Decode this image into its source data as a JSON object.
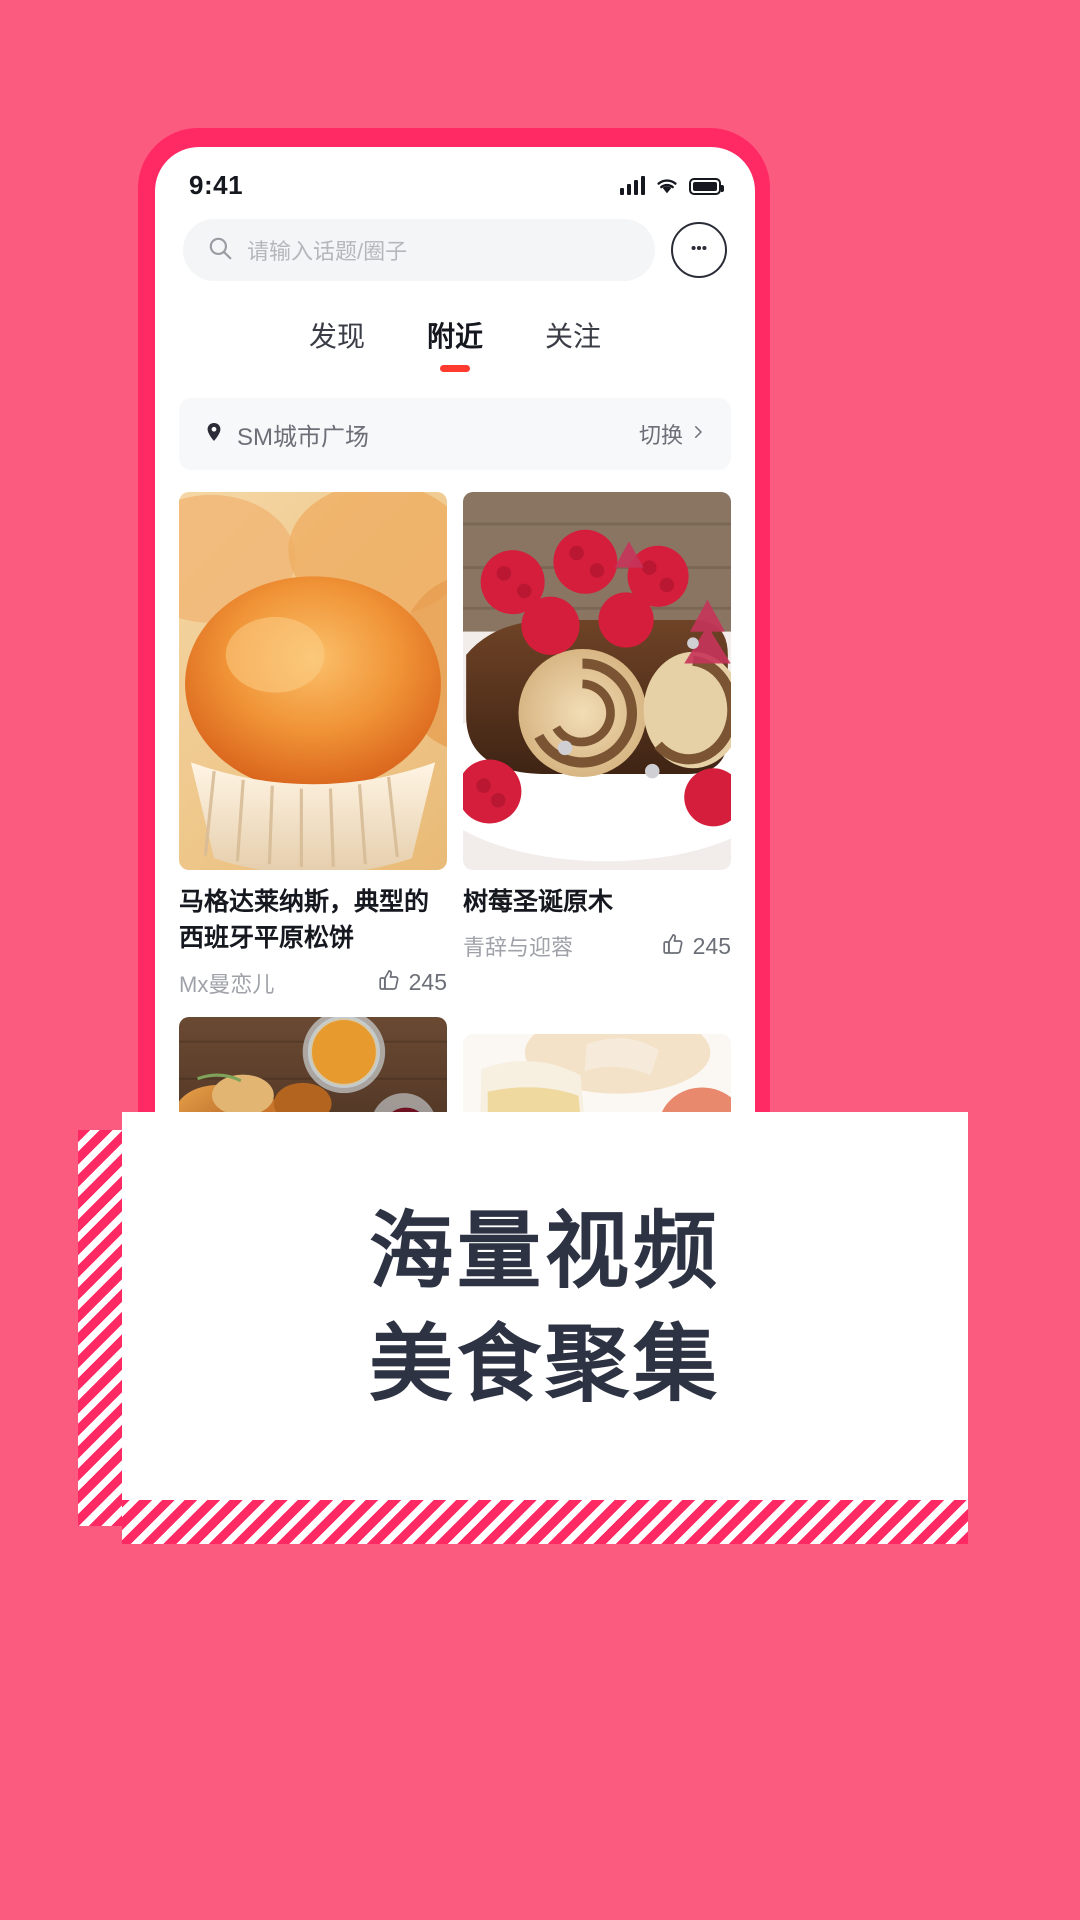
{
  "theme": {
    "bg_pink": "#FC5B80",
    "deep_pink": "#FF2A63",
    "accent_red": "#FF3B30",
    "headline_color": "#2E3344"
  },
  "status_bar": {
    "time": "9:41",
    "icons": [
      "signal-icon",
      "wifi-icon",
      "battery-icon"
    ]
  },
  "search": {
    "placeholder": "请输入话题/圈子",
    "icon": "search-icon",
    "message_icon": "message-dots-icon"
  },
  "tabs": [
    {
      "label": "发现",
      "active": false
    },
    {
      "label": "附近",
      "active": true
    },
    {
      "label": "关注",
      "active": false
    }
  ],
  "location": {
    "icon": "map-pin-icon",
    "name": "SM城市广场",
    "switch_label": "切换",
    "chevron": "chevron-right-icon"
  },
  "feed": {
    "left_column": [
      {
        "title": "马格达莱纳斯，典型的西班牙平原松饼",
        "author": "Mx曼恋儿",
        "likes": "245",
        "like_icon": "thumbs-up-icon",
        "image_alt": "golden-muffin-cupcake"
      },
      {
        "title": "",
        "author": "",
        "likes": "",
        "like_icon": "thumbs-up-icon",
        "image_alt": "roasted-chicken-with-spices"
      }
    ],
    "right_column": [
      {
        "title": "树莓圣诞原木",
        "author": "青辞与迎蓉",
        "likes": "245",
        "like_icon": "thumbs-up-icon",
        "image_alt": "raspberry-chocolate-yule-log"
      },
      {
        "title": "",
        "author": "",
        "likes": "",
        "like_icon": "thumbs-up-icon",
        "image_alt": "cheese-and-fruit-plate"
      }
    ]
  },
  "promo": {
    "line1": "海量视频",
    "line2": "美食聚集"
  }
}
